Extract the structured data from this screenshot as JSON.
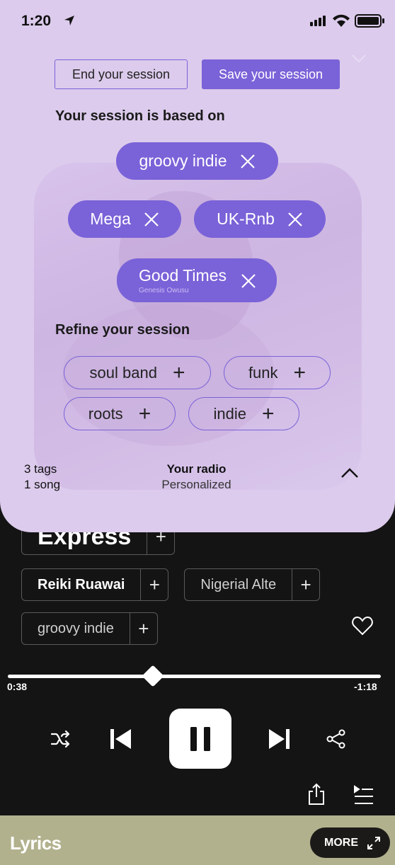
{
  "status_bar": {
    "time": "1:20"
  },
  "session": {
    "end_label": "End your session",
    "save_label": "Save your session",
    "based_on_heading": "Your session is based on",
    "based_on": [
      {
        "label": "groovy indie"
      },
      {
        "label": "Mega"
      },
      {
        "label": "UK-Rnb"
      },
      {
        "label": "Good Times",
        "subtitle": "Genesis Owusu"
      }
    ],
    "refine_heading": "Refine your session",
    "refine": [
      {
        "label": "soul band"
      },
      {
        "label": "funk"
      },
      {
        "label": "roots"
      },
      {
        "label": "indie"
      }
    ],
    "footer": {
      "tags_count": "3 tags",
      "songs_count": "1 song",
      "radio_title": "Your radio",
      "radio_subtitle": "Personalized"
    }
  },
  "player": {
    "tags": [
      {
        "label": "Express"
      },
      {
        "label": "Reiki Ruawai"
      },
      {
        "label": "Nigerial Alte"
      },
      {
        "label": "groovy indie"
      }
    ],
    "progress": {
      "elapsed": "0:38",
      "remaining": "-1:18",
      "fraction": 0.4
    },
    "more_label": "MORE",
    "lyrics_label": "Lyrics"
  },
  "colors": {
    "accent": "#7a62d8",
    "sheet_bg": "#dccbec",
    "lyrics_bar": "#b2b18e",
    "player_bg": "#141414"
  }
}
